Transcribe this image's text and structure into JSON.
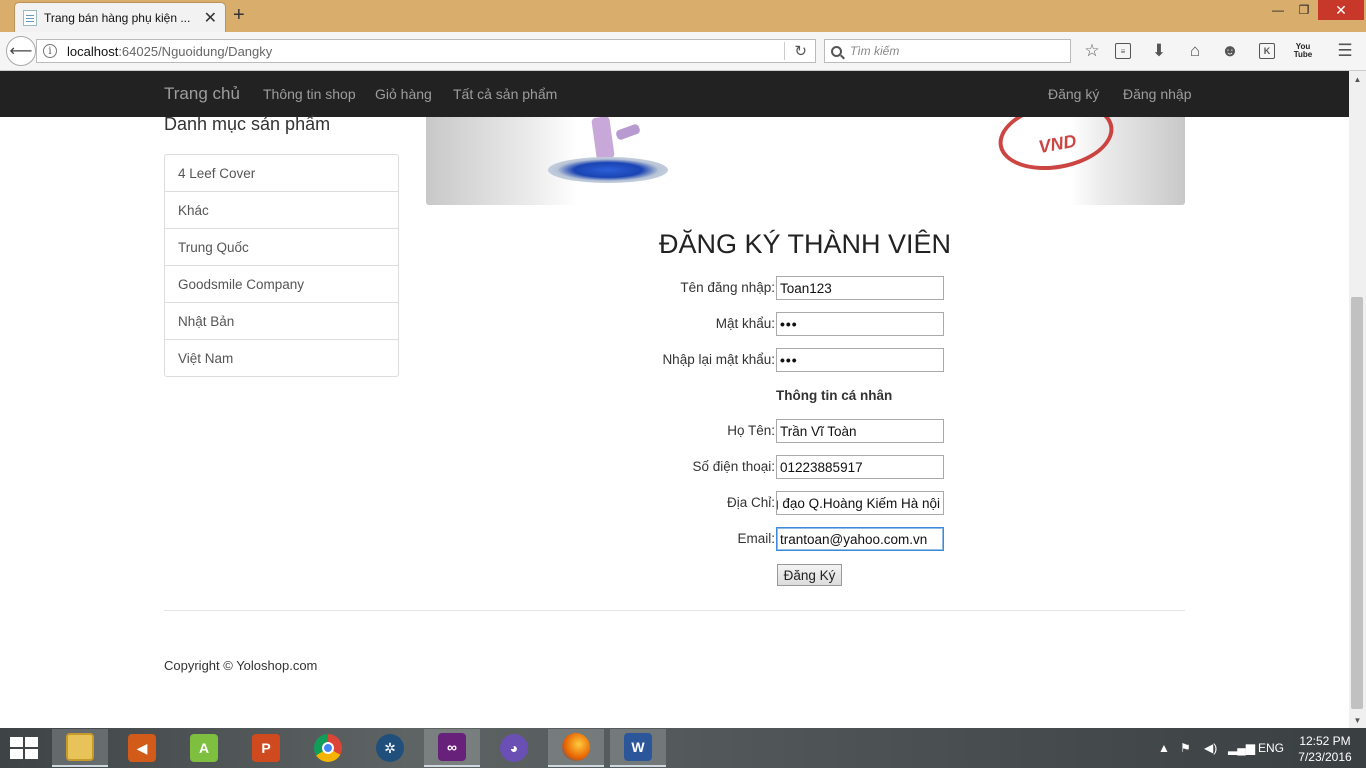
{
  "browser": {
    "tab_title": "Trang bán hàng phụ kiện ...",
    "url_host": "localhost",
    "url_path": ":64025/Nguoidung/Dangky",
    "search_placeholder": "Tìm kiếm"
  },
  "site_nav": {
    "brand": "Trang chủ",
    "links": [
      "Thông tin shop",
      "Giỏ hàng",
      "Tất cả sản phẩm"
    ],
    "right_links": [
      "Đăng ký",
      "Đăng nhập"
    ]
  },
  "sidebar": {
    "heading": "Danh mục sản phẩm",
    "items": [
      "4 Leef Cover",
      "Khác",
      "Trung Quốc",
      "Goodsmile Company",
      "Nhật Bản",
      "Việt Nam"
    ]
  },
  "banner": {
    "stamp_text": "VND"
  },
  "form": {
    "title": "ĐĂNG KÝ THÀNH VIÊN",
    "username_label": "Tên đăng nhập:",
    "username_value": "Toan123",
    "password_label": "Mật khẩu:",
    "password_value": "•••",
    "confirm_label": "Nhập lại mật khẩu:",
    "confirm_value": "•••",
    "section_label": "Thông tin cá nhân",
    "fullname_label": "Họ Tên:",
    "fullname_value": "Trần Vĩ Toàn",
    "phone_label": "Số điện thoại:",
    "phone_value": "01223885917",
    "address_label": "Địa Chỉ:",
    "address_value": "g đạo Q.Hoàng Kiếm Hà nội",
    "email_label": "Email:",
    "email_value": "trantoan@yahoo.com.vn",
    "submit_label": "Đăng Ký"
  },
  "footer": {
    "copyright": "Copyright © Yoloshop.com"
  },
  "taskbar": {
    "language": "ENG",
    "time": "12:52 PM",
    "date": "7/23/2016"
  }
}
